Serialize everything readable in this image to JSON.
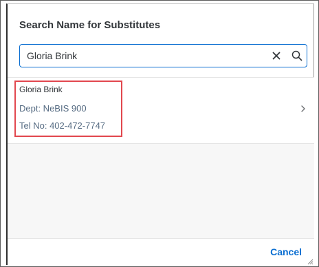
{
  "dialog": {
    "title": "Search Name for Substitutes",
    "search": {
      "value": "Gloria Brink"
    },
    "results": [
      {
        "name": "Gloria Brink",
        "dept": "Dept: NeBIS 900",
        "tel": "Tel No: 402-472-7747"
      }
    ],
    "footer": {
      "cancel_label": "Cancel"
    }
  },
  "colors": {
    "accent": "#0a6ed1",
    "highlight": "#e2474e",
    "title_text": "#32363a",
    "secondary_text": "#556b82"
  },
  "icons": {
    "clear": "close-icon",
    "search": "search-icon",
    "navigate": "chevron-right-icon"
  }
}
